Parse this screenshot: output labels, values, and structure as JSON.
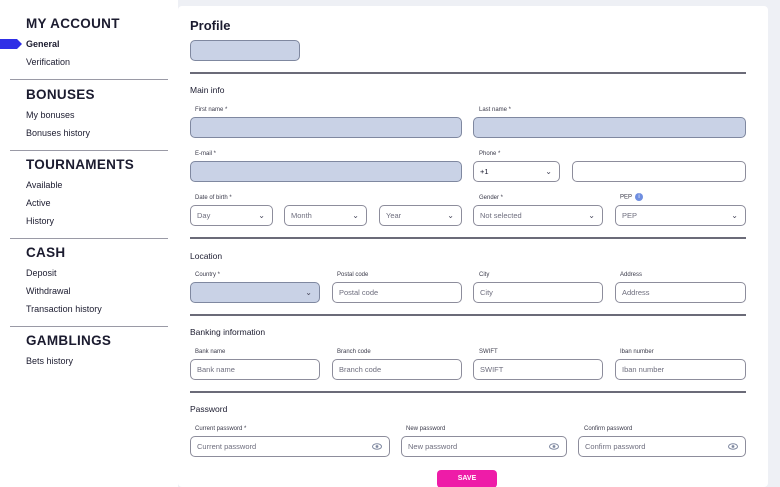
{
  "sidebar": {
    "sections": [
      {
        "title": "MY ACCOUNT",
        "items": [
          "General",
          "Verification"
        ]
      },
      {
        "title": "BONUSES",
        "items": [
          "My bonuses",
          "Bonuses history"
        ]
      },
      {
        "title": "TOURNAMENTS",
        "items": [
          "Available",
          "Active",
          "History"
        ]
      },
      {
        "title": "CASH",
        "items": [
          "Deposit",
          "Withdrawal",
          "Transaction history"
        ]
      },
      {
        "title": "GAMBLINGS",
        "items": [
          "Bets history"
        ]
      }
    ],
    "active_item": "General",
    "accent_color": "#2f2fe6"
  },
  "profile": {
    "title": "Profile",
    "main_info": {
      "heading": "Main info",
      "first_name_label": "First name *",
      "last_name_label": "Last name *",
      "email_label": "E-mail *",
      "phone_label": "Phone *",
      "phone_code": "+1",
      "dob_label": "Date of birth *",
      "day": "Day",
      "month": "Month",
      "year": "Year",
      "gender_label": "Gender *",
      "gender_value": "Not selected",
      "pep_label": "PEP",
      "pep_value": "PEP"
    },
    "location": {
      "heading": "Location",
      "country_label": "Country *",
      "postal_label": "Postal code",
      "postal_placeholder": "Postal code",
      "city_label": "City",
      "city_placeholder": "City",
      "address_label": "Address",
      "address_placeholder": "Address"
    },
    "banking": {
      "heading": "Banking information",
      "bank_label": "Bank name",
      "bank_placeholder": "Bank name",
      "branch_label": "Branch code",
      "branch_placeholder": "Branch code",
      "swift_label": "SWIFT",
      "swift_placeholder": "SWIFT",
      "iban_label": "Iban number",
      "iban_placeholder": "Iban number"
    },
    "password": {
      "heading": "Password",
      "current_label": "Current password *",
      "current_placeholder": "Current password",
      "new_label": "New password",
      "new_placeholder": "New password",
      "confirm_label": "Confirm password",
      "confirm_placeholder": "Confirm password"
    },
    "save_label": "SAVE",
    "colors": {
      "filled_field": "#c9d2e6",
      "save_button": "#ee1ca8"
    }
  }
}
